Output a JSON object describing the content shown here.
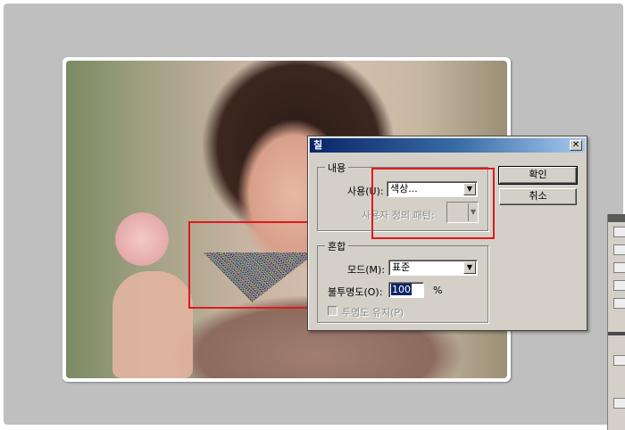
{
  "dialog": {
    "title": "칠",
    "close_glyph": "✕",
    "contents_group": {
      "legend": "내용",
      "use_label": "사용(U):",
      "use_value": "색상...",
      "custom_pattern_label": "사용자 정의 패턴:"
    },
    "blending_group": {
      "legend": "혼합",
      "mode_label": "모드(M):",
      "mode_value": "표준",
      "opacity_label": "불투명도(O):",
      "opacity_value": "100",
      "opacity_unit": "%",
      "preserve_transparency_label": "투명도 유지(P)"
    },
    "ok_label": "확인",
    "cancel_label": "취소"
  },
  "icons": {
    "dropdown_arrow": "▼",
    "close": "close-icon"
  },
  "colors": {
    "highlight_box": "#e0191c",
    "titlebar_start": "#0a246a",
    "titlebar_end": "#a6caf0",
    "workspace": "#bfbfbf",
    "dialog_face": "#d4d0c8"
  }
}
